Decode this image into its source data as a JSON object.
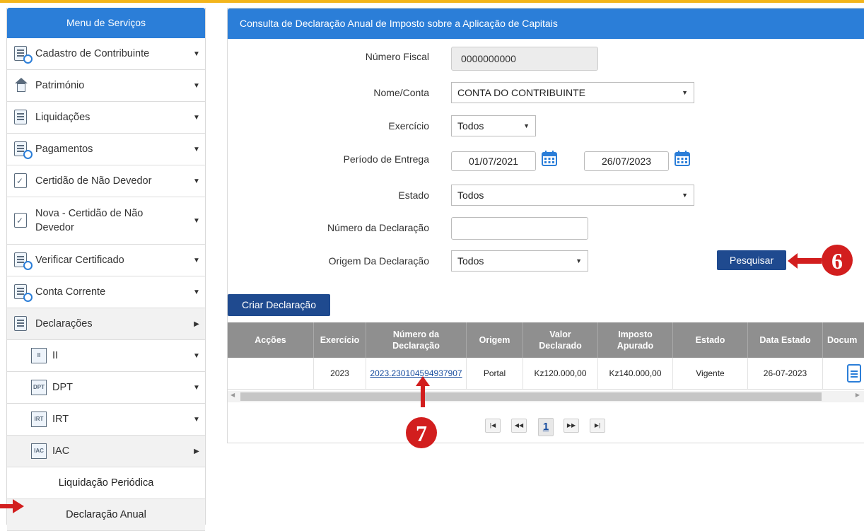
{
  "sidebar": {
    "title": "Menu de Serviços",
    "items": [
      {
        "label": "Cadastro de Contribuinte",
        "icon": "doc-search-icon"
      },
      {
        "label": "Património",
        "icon": "house-icon"
      },
      {
        "label": "Liquidações",
        "icon": "doc-edit-icon"
      },
      {
        "label": "Pagamentos",
        "icon": "doc-search-icon"
      },
      {
        "label": "Certidão de Não Devedor",
        "icon": "certificate-icon"
      },
      {
        "label": "Nova - Certidão de Não Devedor",
        "icon": "certificate-icon"
      },
      {
        "label": "Verificar Certificado",
        "icon": "doc-search-icon"
      },
      {
        "label": "Conta Corrente",
        "icon": "doc-search-icon"
      },
      {
        "label": "Declarações",
        "icon": "doc-icon"
      },
      {
        "label": "II",
        "tag": "II"
      },
      {
        "label": "DPT",
        "tag": "DPT"
      },
      {
        "label": "IRT",
        "tag": "IRT"
      },
      {
        "label": "IAC",
        "tag": "IAC"
      }
    ],
    "subitems": [
      {
        "label": "Liquidação Periódica"
      },
      {
        "label": "Declaração Anual"
      }
    ]
  },
  "panel": {
    "title": "Consulta de Declaração Anual de Imposto sobre a Aplicação de Capitais",
    "labels": {
      "nif": "Número Fiscal",
      "nome": "Nome/Conta",
      "exercicio": "Exercício",
      "periodo": "Período de Entrega",
      "estado": "Estado",
      "numero": "Número da Declaração",
      "origem": "Origem Da Declaração"
    },
    "values": {
      "nif": "0000000000",
      "nome": "CONTA DO CONTRIBUINTE",
      "exercicio": "Todos",
      "data_inicio": "01/07/2021",
      "data_fim": "26/07/2023",
      "estado": "Todos",
      "numero": "",
      "origem": "Todos"
    },
    "search_button": "Pesquisar",
    "create_button": "Criar Declaração",
    "badge_search": "6",
    "badge_link": "7"
  },
  "table": {
    "headers": [
      "Acções",
      "Exercício",
      "Número da\nDeclaração",
      "Origem",
      "Valor\nDeclarado",
      "Imposto\nApurado",
      "Estado",
      "Data Estado",
      "Docum"
    ],
    "row": [
      "",
      "2023",
      "2023.230104594937907",
      "Portal",
      "Kz120.000,00",
      "Kz140.000,00",
      "Vigente",
      "26-07-2023",
      ""
    ]
  },
  "pagination": {
    "first": "|◀",
    "prev": "◀◀",
    "current": "1",
    "next": "▶▶",
    "last": "▶|"
  },
  "colors": {
    "accent": "#2b7ed8",
    "button": "#1f4a8f",
    "badge": "#d21e1e",
    "topline": "#f3b51b"
  }
}
